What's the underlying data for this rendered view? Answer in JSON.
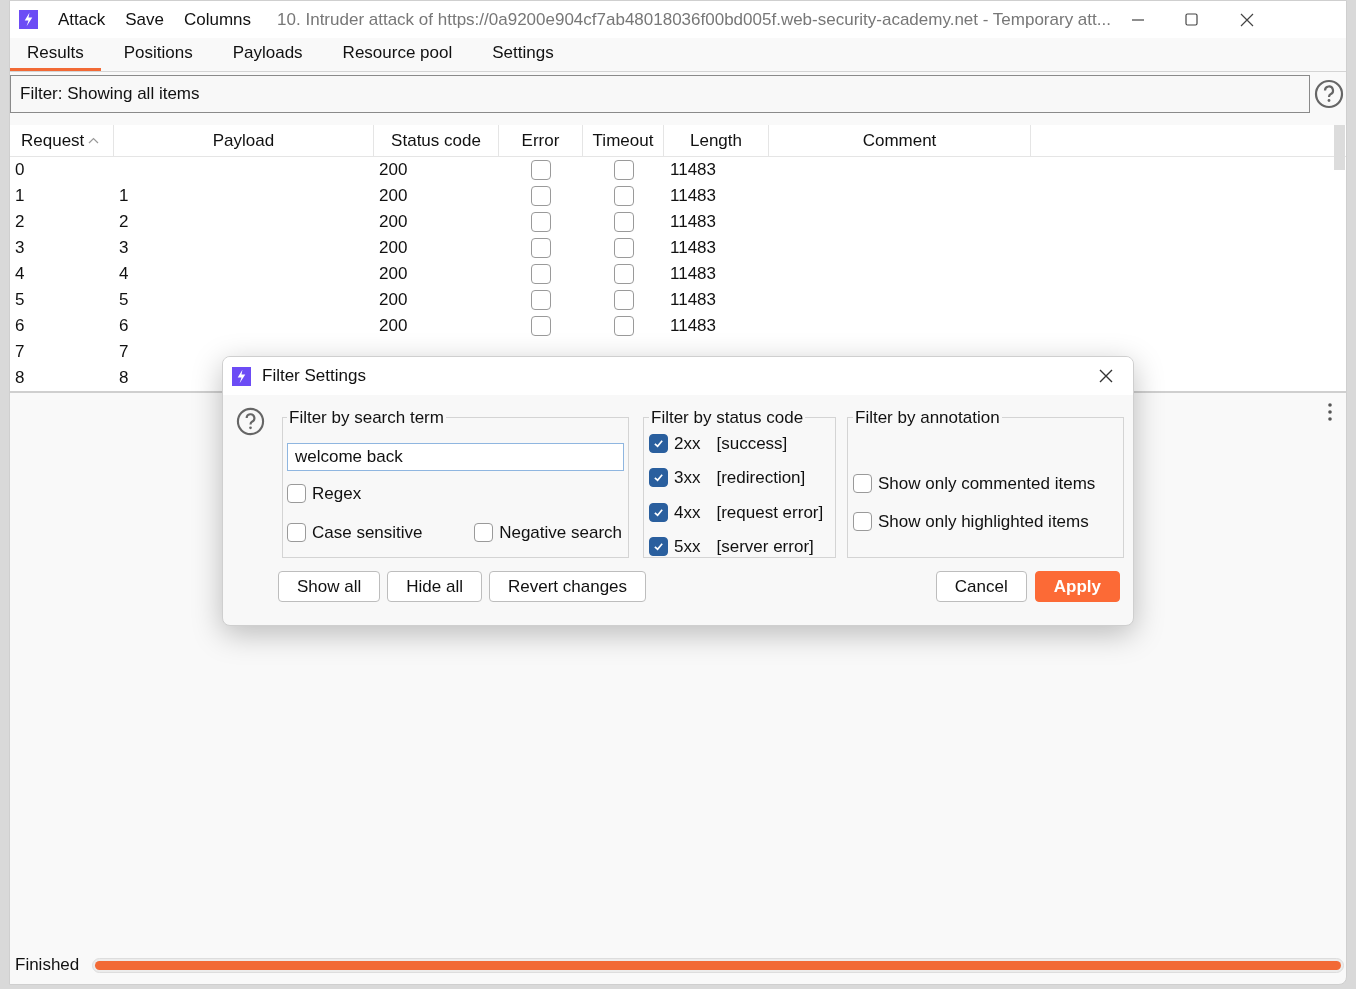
{
  "window": {
    "menu": [
      "Attack",
      "Save",
      "Columns"
    ],
    "title": "10. Intruder attack of https://0a9200e904cf7ab48018036f00bd005f.web-security-academy.net - Temporary att..."
  },
  "tabs": [
    {
      "label": "Results",
      "selected": true
    },
    {
      "label": "Positions",
      "selected": false
    },
    {
      "label": "Payloads",
      "selected": false
    },
    {
      "label": "Resource pool",
      "selected": false
    },
    {
      "label": "Settings",
      "selected": false
    }
  ],
  "filter_bar": {
    "text": "Filter: Showing all items"
  },
  "table": {
    "columns": [
      {
        "label": "Request",
        "sorted": true
      },
      {
        "label": "Payload",
        "sorted": false
      },
      {
        "label": "Status code",
        "sorted": false
      },
      {
        "label": "Error",
        "sorted": false
      },
      {
        "label": "Timeout",
        "sorted": false
      },
      {
        "label": "Length",
        "sorted": false
      },
      {
        "label": "Comment",
        "sorted": false
      }
    ],
    "rows": [
      {
        "request": "0",
        "status": "200",
        "error": false,
        "timeout": false,
        "length": "11483"
      },
      {
        "request": "1",
        "payload": "1",
        "status": "200",
        "error": false,
        "timeout": false,
        "length": "11483"
      },
      {
        "request": "2",
        "payload": "2",
        "status": "200",
        "error": false,
        "timeout": false,
        "length": "11483"
      },
      {
        "request": "3",
        "payload": "3",
        "status": "200",
        "error": false,
        "timeout": false,
        "length": "11483"
      },
      {
        "request": "4",
        "payload": "4",
        "status": "200",
        "error": false,
        "timeout": false,
        "length": "11483"
      },
      {
        "request": "5",
        "payload": "5",
        "status": "200",
        "error": false,
        "timeout": false,
        "length": "11483"
      },
      {
        "request": "6",
        "payload": "6",
        "status": "200",
        "error": false,
        "timeout": false,
        "length": "11483"
      },
      {
        "request": "7",
        "payload": "7"
      },
      {
        "request": "8",
        "payload": "8"
      }
    ]
  },
  "dialog": {
    "title": "Filter Settings",
    "search_group": {
      "legend": "Filter by search term",
      "value": "welcome back",
      "options": [
        {
          "label": "Regex",
          "checked": false
        },
        {
          "label": "Case sensitive",
          "checked": false
        },
        {
          "label": "Negative search",
          "checked": false
        }
      ]
    },
    "status_group": {
      "legend": "Filter by status code",
      "options": [
        {
          "code": "2xx",
          "label": "[success]",
          "checked": true
        },
        {
          "code": "3xx",
          "label": "[redirection]",
          "checked": true
        },
        {
          "code": "4xx",
          "label": "[request error]",
          "checked": true
        },
        {
          "code": "5xx",
          "label": "[server error]",
          "checked": true
        }
      ]
    },
    "annotation_group": {
      "legend": "Filter by annotation",
      "options": [
        {
          "label": "Show only commented items",
          "checked": false
        },
        {
          "label": "Show only highlighted items",
          "checked": false
        }
      ]
    },
    "left_buttons": [
      "Show all",
      "Hide all",
      "Revert changes"
    ],
    "right_buttons": [
      {
        "label": "Cancel",
        "kind": "secondary"
      },
      {
        "label": "Apply",
        "kind": "primary"
      }
    ]
  },
  "status_bar": {
    "text": "Finished",
    "level": 1
  }
}
